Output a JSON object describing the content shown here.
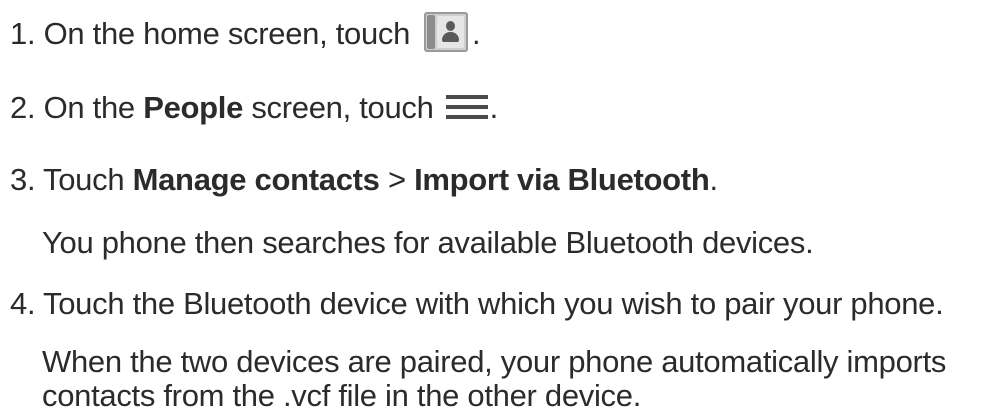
{
  "steps": [
    {
      "number": "1.",
      "text_before": "On the home screen, touch",
      "icon": "contacts-app-icon",
      "text_after": "."
    },
    {
      "number": "2.",
      "text_before": "On the",
      "bold": "People",
      "text_middle": "screen, touch",
      "icon": "menu-icon",
      "text_after": "."
    },
    {
      "number": "3.",
      "text_before": "Touch",
      "bold_1": "Manage contacts",
      "separator": ">",
      "bold_2": "Import via Bluetooth",
      "text_after": "."
    },
    {
      "note": "You phone then searches for available Bluetooth devices."
    },
    {
      "number": "4.",
      "text": "Touch the Bluetooth device with which you wish to pair your phone."
    },
    {
      "note_line_1": "When the two devices are paired, your phone automatically imports",
      "note_line_2": "contacts from the .vcf file in the other device."
    }
  ]
}
